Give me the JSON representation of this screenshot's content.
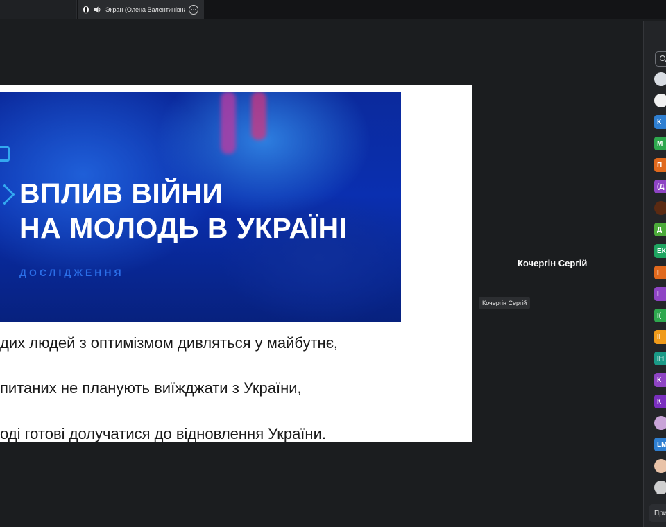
{
  "tabs": {
    "screen_label": "Экран (Олена Валентинівна"
  },
  "slide": {
    "banner_title_line1": "ВПЛИВ ВІЙНИ",
    "banner_title_line2": "НА МОЛОДЬ В УКРАЇНІ",
    "banner_subtitle": "ДОСЛІДЖЕННЯ",
    "lines": [
      "дих людей з оптимізмом дивляться у майбутнє,",
      "питаних не планують виїжджати з України,",
      "оді готові долучатися до відновлення України."
    ]
  },
  "speaker": {
    "name": "Кочергін Сергій",
    "tooltip": "Кочергін Сергій"
  },
  "participants": {
    "avatars": [
      {
        "initials": "",
        "color": "#d9dde3"
      },
      {
        "initials": "",
        "color": "#f2f2f2"
      },
      {
        "initials": "К",
        "color": "#2f7fd1"
      },
      {
        "initials": "М",
        "color": "#2ea84e"
      },
      {
        "initials": "П",
        "color": "#e0691d"
      },
      {
        "initials": "(Д",
        "color": "#8e44c4"
      },
      {
        "initials": "",
        "color": "#5a2a12"
      },
      {
        "initials": "Д",
        "color": "#4caa3a"
      },
      {
        "initials": "ЕК",
        "color": "#1fa561"
      },
      {
        "initials": "І",
        "color": "#e0691d"
      },
      {
        "initials": "І",
        "color": "#8e44c4"
      },
      {
        "initials": "І(",
        "color": "#2ea84e"
      },
      {
        "initials": "ІІ",
        "color": "#f09b1a"
      },
      {
        "initials": "ІН",
        "color": "#1a9a87"
      },
      {
        "initials": "К",
        "color": "#8e44c4"
      },
      {
        "initials": "К",
        "color": "#7a2fbf"
      },
      {
        "initials": "",
        "color": "#c9a4d8"
      },
      {
        "initials": "LM",
        "color": "#2f7fd1"
      },
      {
        "initials": "",
        "color": "#e9c3a8"
      },
      {
        "initials": "",
        "color": "#cfcfcf"
      }
    ],
    "footer_label": "При"
  }
}
